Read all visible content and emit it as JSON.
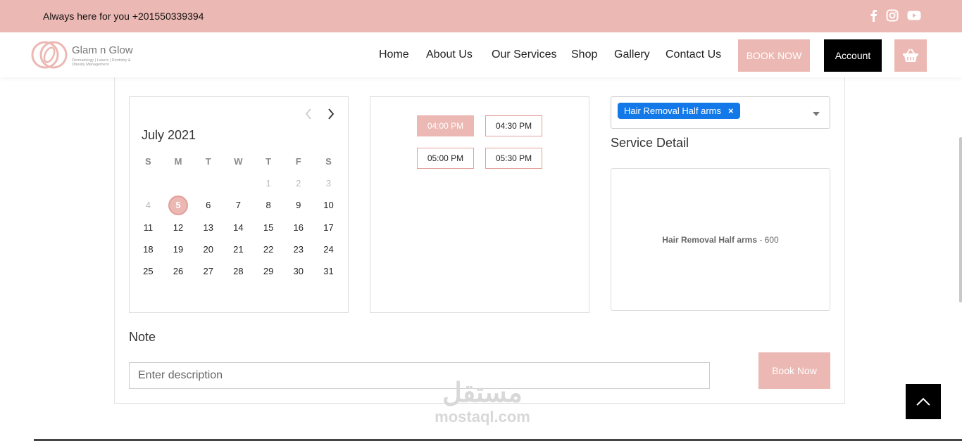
{
  "topbar": {
    "phone_text": "Always here for you +201550339394",
    "social_icons": [
      "facebook-icon",
      "instagram-icon",
      "youtube-icon"
    ]
  },
  "brand": {
    "name": "Glam n Glow",
    "tagline": "Dermatology | Lasers | Dentistry & Obesity Management"
  },
  "nav": {
    "items": [
      "Home",
      "About Us",
      "Our Services",
      "Shop",
      "Gallery",
      "Contact Us"
    ],
    "book_now": "BOOK NOW",
    "account": "Account",
    "cart_icon": "basket-icon"
  },
  "calendar": {
    "month": "July 2021",
    "weekdays": [
      "S",
      "M",
      "T",
      "W",
      "T",
      "F",
      "S"
    ],
    "weeks": [
      [
        "",
        "",
        "",
        "",
        "1",
        "2",
        "3"
      ],
      [
        "4",
        "5",
        "6",
        "7",
        "8",
        "9",
        "10"
      ],
      [
        "11",
        "12",
        "13",
        "14",
        "15",
        "16",
        "17"
      ],
      [
        "18",
        "19",
        "20",
        "21",
        "22",
        "23",
        "24"
      ],
      [
        "25",
        "26",
        "27",
        "28",
        "29",
        "30",
        "31"
      ]
    ],
    "selected_day": "5",
    "disabled_days": [
      "1",
      "2",
      "3",
      "4"
    ]
  },
  "time_slots": {
    "slots": [
      "04:00 PM",
      "04:30 PM",
      "05:00 PM",
      "05:30 PM"
    ],
    "selected": "04:00 PM"
  },
  "service_select": {
    "selected_chip": "Hair Removal Half arms",
    "remove_symbol": "×"
  },
  "service_detail": {
    "title": "Service Detail",
    "name": "Hair Removal Half arms",
    "price_text": " - 600"
  },
  "note": {
    "label": "Note",
    "placeholder": "Enter description"
  },
  "book_button": "Book Now",
  "watermark": {
    "arabic": "مستقل",
    "latin": "mostaql.com"
  },
  "colors": {
    "accent": "#ecb8b3",
    "chip": "#1479e8",
    "dark": "#000000"
  }
}
